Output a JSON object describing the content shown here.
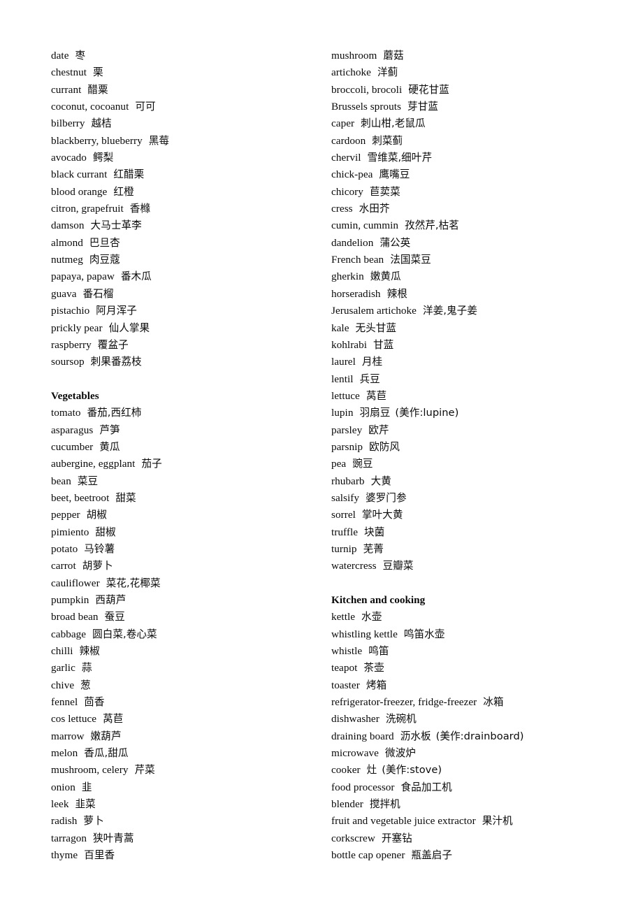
{
  "document": {
    "page_background": "#ffffff",
    "text_color": "#0a0a0a",
    "columns": [
      {
        "name": "left-column",
        "blocks": [
          {
            "type": "entries",
            "entries": [
              {
                "term": "date",
                "gloss": "枣"
              },
              {
                "term": "chestnut",
                "gloss": "栗"
              },
              {
                "term": "currant",
                "gloss": "醋粟"
              },
              {
                "term": "coconut, cocoanut",
                "gloss": "可可"
              },
              {
                "term": "bilberry",
                "gloss": "越桔"
              },
              {
                "term": "blackberry, blueberry",
                "gloss": "黑莓"
              },
              {
                "term": "avocado",
                "gloss": "鳄梨"
              },
              {
                "term": "black currant",
                "gloss": "红醋栗"
              },
              {
                "term": "blood orange",
                "gloss": "红橙"
              },
              {
                "term": "citron, grapefruit",
                "gloss": "香橼"
              },
              {
                "term": "damson",
                "gloss": "大马士革李"
              },
              {
                "term": "almond",
                "gloss": "巴旦杏"
              },
              {
                "term": "nutmeg",
                "gloss": "肉豆蔻"
              },
              {
                "term": "papaya, papaw",
                "gloss": "番木瓜"
              },
              {
                "term": "guava",
                "gloss": "番石榴"
              },
              {
                "term": "pistachio",
                "gloss": "阿月浑子"
              },
              {
                "term": "prickly pear",
                "gloss": "仙人掌果"
              },
              {
                "term": "raspberry",
                "gloss": "覆盆子"
              },
              {
                "term": "soursop",
                "gloss": "刺果番荔枝"
              }
            ]
          },
          {
            "type": "spacer"
          },
          {
            "type": "heading",
            "text": "Vegetables"
          },
          {
            "type": "entries",
            "entries": [
              {
                "term": "tomato",
                "gloss": "番茄,西红柿"
              },
              {
                "term": "asparagus",
                "gloss": "芦笋"
              },
              {
                "term": "cucumber",
                "gloss": "黄瓜"
              },
              {
                "term": "aubergine, eggplant",
                "gloss": "茄子"
              },
              {
                "term": "bean",
                "gloss": "菜豆"
              },
              {
                "term": "beet, beetroot",
                "gloss": "甜菜"
              },
              {
                "term": "pepper",
                "gloss": "胡椒"
              },
              {
                "term": "pimiento",
                "gloss": "甜椒"
              },
              {
                "term": "potato",
                "gloss": "马铃薯"
              },
              {
                "term": "carrot",
                "gloss": "胡萝卜"
              },
              {
                "term": "cauliflower",
                "gloss": "菜花,花椰菜"
              },
              {
                "term": "pumpkin",
                "gloss": "西葫芦"
              },
              {
                "term": "broad bean",
                "gloss": "蚕豆"
              },
              {
                "term": "cabbage",
                "gloss": "圆白菜,卷心菜"
              },
              {
                "term": "chilli",
                "gloss": "辣椒"
              },
              {
                "term": "garlic",
                "gloss": "蒜"
              },
              {
                "term": "chive",
                "gloss": "葱"
              },
              {
                "term": "fennel",
                "gloss": "茴香"
              },
              {
                "term": "cos lettuce",
                "gloss": "莴苣"
              },
              {
                "term": "marrow",
                "gloss": "嫩葫芦"
              },
              {
                "term": "melon",
                "gloss": "香瓜,甜瓜"
              },
              {
                "term": "mushroom, celery",
                "gloss": "芹菜"
              },
              {
                "term": "onion",
                "gloss": "韭"
              },
              {
                "term": "leek",
                "gloss": "韭菜"
              },
              {
                "term": "radish",
                "gloss": "萝卜"
              },
              {
                "term": "tarragon",
                "gloss": "狭叶青蒿"
              },
              {
                "term": "thyme",
                "gloss": "百里香"
              }
            ]
          }
        ]
      },
      {
        "name": "right-column",
        "blocks": [
          {
            "type": "entries",
            "entries": [
              {
                "term": "mushroom",
                "gloss": "蘑菇"
              },
              {
                "term": "artichoke",
                "gloss": "洋蓟"
              },
              {
                "term": "broccoli, brocoli",
                "gloss": "硬花甘蓝"
              },
              {
                "term": "Brussels sprouts",
                "gloss": "芽甘蓝"
              },
              {
                "term": "caper",
                "gloss": "刺山柑,老鼠瓜"
              },
              {
                "term": "cardoon",
                "gloss": "刺菜蓟"
              },
              {
                "term": "chervil",
                "gloss": "雪维菜,细叶芹"
              },
              {
                "term": "chick-pea",
                "gloss": "鹰嘴豆"
              },
              {
                "term": "chicory",
                "gloss": "苣荬菜"
              },
              {
                "term": "cress",
                "gloss": "水田芥"
              },
              {
                "term": "cumin, cummin",
                "gloss": "孜然芹,枯茗"
              },
              {
                "term": "dandelion",
                "gloss": "蒲公英"
              },
              {
                "term": "French bean",
                "gloss": "法国菜豆"
              },
              {
                "term": "gherkin",
                "gloss": "嫩黄瓜"
              },
              {
                "term": "horseradish",
                "gloss": "辣根"
              },
              {
                "term": "Jerusalem artichoke",
                "gloss": "洋姜,鬼子姜"
              },
              {
                "term": "kale",
                "gloss": "无头甘蓝"
              },
              {
                "term": "kohlrabi",
                "gloss": "甘蓝"
              },
              {
                "term": "laurel",
                "gloss": "月桂"
              },
              {
                "term": "lentil",
                "gloss": "兵豆"
              },
              {
                "term": "lettuce",
                "gloss": "莴苣"
              },
              {
                "term": "lupin",
                "gloss": "羽扇豆",
                "note": "(美作:lupine)"
              },
              {
                "term": "parsley",
                "gloss": "欧芹"
              },
              {
                "term": "parsnip",
                "gloss": "欧防风"
              },
              {
                "term": "pea",
                "gloss": "豌豆"
              },
              {
                "term": "rhubarb",
                "gloss": "大黄"
              },
              {
                "term": "salsify",
                "gloss": "婆罗门参"
              },
              {
                "term": "sorrel",
                "gloss": "掌叶大黄"
              },
              {
                "term": "truffle",
                "gloss": "块菌"
              },
              {
                "term": "turnip",
                "gloss": "芜菁"
              },
              {
                "term": "watercress",
                "gloss": "豆瓣菜"
              }
            ]
          },
          {
            "type": "spacer"
          },
          {
            "type": "heading",
            "text": "Kitchen and cooking"
          },
          {
            "type": "entries",
            "entries": [
              {
                "term": "kettle",
                "gloss": "水壶"
              },
              {
                "term": "whistling kettle",
                "gloss": "鸣笛水壶"
              },
              {
                "term": "whistle",
                "gloss": "鸣笛"
              },
              {
                "term": "teapot",
                "gloss": "茶壶"
              },
              {
                "term": "toaster",
                "gloss": "烤箱"
              },
              {
                "term": "refrigerator-freezer, fridge-freezer",
                "gloss": "冰箱"
              },
              {
                "term": "dishwasher",
                "gloss": "洗碗机"
              },
              {
                "term": "draining board",
                "gloss": "沥水板",
                "note": "(美作:drainboard)"
              },
              {
                "term": "microwave",
                "gloss": "微波炉"
              },
              {
                "term": "cooker",
                "gloss": "灶",
                "note": "(美作:stove)"
              },
              {
                "term": "food processor",
                "gloss": "食品加工机"
              },
              {
                "term": "blender",
                "gloss": "搅拌机"
              },
              {
                "term": "fruit and vegetable juice extractor",
                "gloss": "果汁机"
              },
              {
                "term": "corkscrew",
                "gloss": "开塞钻"
              },
              {
                "term": "bottle cap opener",
                "gloss": "瓶盖启子"
              }
            ]
          }
        ]
      }
    ]
  }
}
